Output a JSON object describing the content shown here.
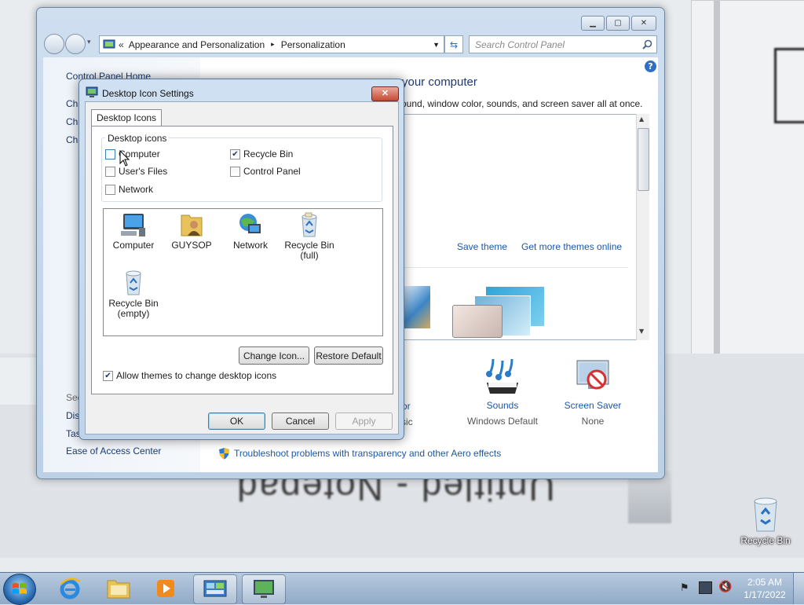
{
  "desktop": {
    "notepad_mirror_text": "Untitled - Notepad",
    "recycle_bin_label": "Recycle Bin"
  },
  "control_panel": {
    "breadcrumb_prefix": "«",
    "breadcrumb_1": "Appearance and Personalization",
    "breadcrumb_sep": "▸",
    "breadcrumb_2": "Personalization",
    "search_placeholder": "Search Control Panel",
    "home_link": "Control Panel Home",
    "left_links_partial": [
      "Cha",
      "Cha",
      "Cha"
    ],
    "see_also_partial": "See",
    "bottom_links_partial": [
      "Dis",
      "Tas"
    ],
    "ease_access": "Ease of Access Center",
    "heading_partial": "your computer",
    "subtitle_partial": "ound, window color, sounds, and screen saver all at once.",
    "save_theme": "Save theme",
    "more_themes": "Get more themes online",
    "color_partial": "or",
    "color_sub_partial": "sic",
    "sounds_label": "Sounds",
    "sounds_value": "Windows Default",
    "screensaver_label": "Screen Saver",
    "screensaver_value": "None",
    "troubleshoot_link": "Troubleshoot problems with transparency and other Aero effects"
  },
  "dialog": {
    "title": "Desktop Icon Settings",
    "tab": "Desktop Icons",
    "group_label": "Desktop icons",
    "checkboxes": [
      {
        "label": "Computer",
        "checked": false
      },
      {
        "label": "Recycle Bin",
        "checked": true
      },
      {
        "label": "User's Files",
        "checked": false
      },
      {
        "label": "Control Panel",
        "checked": false
      },
      {
        "label": "Network",
        "checked": false
      }
    ],
    "icons": [
      {
        "label": "Computer"
      },
      {
        "label": "GUYSOP"
      },
      {
        "label": "Network"
      },
      {
        "label": "Recycle Bin",
        "label2": "(full)"
      },
      {
        "label": "Recycle Bin",
        "label2": "(empty)"
      }
    ],
    "change_icon": "Change Icon...",
    "restore_default": "Restore Default",
    "allow_themes": "Allow themes to change desktop icons",
    "allow_themes_checked": true,
    "ok": "OK",
    "cancel": "Cancel",
    "apply": "Apply"
  },
  "taskbar": {
    "time": "2:05 AM",
    "date": "1/17/2022"
  }
}
